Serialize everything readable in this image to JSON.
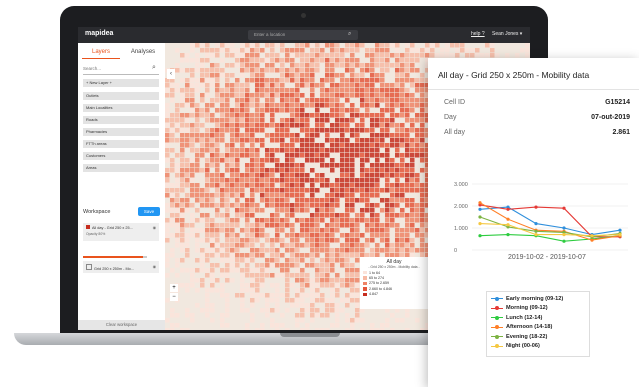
{
  "app": {
    "logo": "mapidea",
    "location_placeholder": "Enter a location",
    "help_label": "help ?",
    "user_label": "Sean Jones ▾"
  },
  "sidebar": {
    "tabs": [
      "Layers",
      "Analyses"
    ],
    "search_placeholder": "Search...",
    "new_layer_label": "+ New Layer +",
    "layers": [
      "Outlets",
      "Main Localities",
      "Roads",
      "Pharmacies",
      "FTTh areas",
      "Customers",
      "Areas"
    ],
    "workspace_label": "Workspace",
    "save_label": "Save",
    "workspace_items": [
      {
        "label": "All day - Grid 250 x 25...",
        "sub": "Opacity 80%"
      },
      {
        "label": "Grid 250 x 250m - Mo..."
      }
    ],
    "opacity_fraction": 0.94,
    "clear_label": "Clear workspace"
  },
  "map": {
    "collapse_icon": "‹",
    "zoom_in": "+",
    "zoom_out": "−",
    "legend": {
      "title": "All day",
      "subtitle": "- Grid 250 x 250m - Mobility data -",
      "items": [
        {
          "label": "1 to 64",
          "color": "#fbe3da"
        },
        {
          "label": "65 to 274",
          "color": "#f7b9a3"
        },
        {
          "label": "275 to 2.659",
          "color": "#ef8466"
        },
        {
          "label": "2.660 to 4.846",
          "color": "#e4563b"
        },
        {
          "label": "4.847",
          "color": "#c62d1f"
        }
      ]
    }
  },
  "panel": {
    "title": "All day - Grid 250 x 250m - Mobility data",
    "fields": [
      {
        "label": "Cell ID",
        "value": "G15214"
      },
      {
        "label": "Day",
        "value": "07-out-2019"
      },
      {
        "label": "All day",
        "value": "2.861"
      }
    ],
    "date_range": "2019-10-02 - 2019-10-07"
  },
  "chart_data": {
    "type": "line",
    "x": [
      "2019-10-02",
      "2019-10-03",
      "2019-10-04",
      "2019-10-05",
      "2019-10-06",
      "2019-10-07"
    ],
    "yticks": [
      "3.000",
      "2.000",
      "1.000",
      "0"
    ],
    "ylim": [
      0,
      3000
    ],
    "xlabel": "2019-10-02 - 2019-10-07",
    "series": [
      {
        "name": "Early morning (09-12)",
        "color": "#2f8fdc",
        "values": [
          1850,
          1950,
          1200,
          1000,
          700,
          900
        ]
      },
      {
        "name": "Morning (09-12)",
        "color": "#e53935",
        "values": [
          2050,
          1850,
          1950,
          1900,
          600,
          600
        ]
      },
      {
        "name": "Lunch (12-14)",
        "color": "#2ecc40",
        "values": [
          650,
          700,
          650,
          400,
          500,
          650
        ]
      },
      {
        "name": "Afternoon (14-18)",
        "color": "#ff7f27",
        "values": [
          2150,
          1400,
          900,
          850,
          450,
          650
        ]
      },
      {
        "name": "Evening (18-22)",
        "color": "#7cb342",
        "values": [
          1500,
          1050,
          850,
          800,
          600,
          750
        ]
      },
      {
        "name": "Night (00-06)",
        "color": "#f5c842",
        "values": [
          1200,
          1150,
          700,
          700,
          650,
          700
        ]
      }
    ]
  }
}
